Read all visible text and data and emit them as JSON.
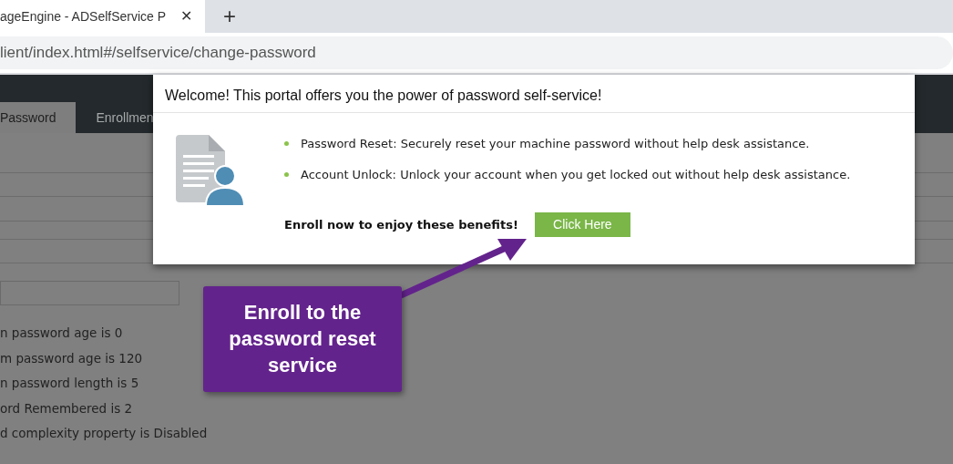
{
  "browser": {
    "tab": {
      "title": "ageEngine - ADSelfService P",
      "close": "✕"
    },
    "new_tab": "+",
    "address": "lient/index.html#/selfservice/change-password"
  },
  "nav_tabs": [
    {
      "label": "Password",
      "selected": true
    },
    {
      "label": "Enrollmen",
      "selected": false
    }
  ],
  "policy": [
    "n password age is 0",
    "m password age is 120",
    "n password length is 5",
    "ord Remembered is 2",
    "d complexity property is Disabled"
  ],
  "popup": {
    "title": "Welcome! This portal offers you the power of password self-service!",
    "benefits": [
      "Password Reset: Securely reset your machine password without help desk assistance.",
      "Account Unlock: Unlock your account when you get locked out without help desk assistance."
    ],
    "enroll_text": "Enroll now to enjoy these benefits!",
    "button": "Click Here"
  },
  "callout": {
    "text": "Enroll to the password reset service"
  }
}
